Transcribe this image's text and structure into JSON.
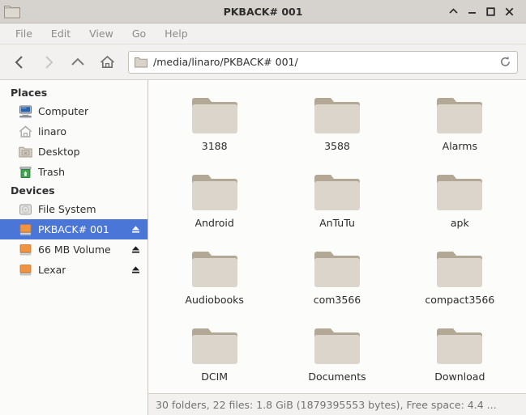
{
  "window": {
    "title": "PKBACK# 001",
    "title_icon": "folder-outline-icon",
    "controls": [
      {
        "name": "shade-button",
        "glyph": "∧"
      },
      {
        "name": "minimize-button",
        "glyph": "–"
      },
      {
        "name": "maximize-button",
        "glyph": "□"
      },
      {
        "name": "close-button",
        "glyph": "✕"
      }
    ]
  },
  "menubar": {
    "items": [
      {
        "label": "File"
      },
      {
        "label": "Edit"
      },
      {
        "label": "View"
      },
      {
        "label": "Go"
      },
      {
        "label": "Help"
      }
    ]
  },
  "toolbar": {
    "back": {
      "name": "back-button",
      "enabled": false
    },
    "forward": {
      "name": "forward-button",
      "enabled": false
    },
    "up": {
      "name": "up-button",
      "enabled": true
    },
    "home": {
      "name": "home-button",
      "enabled": true
    },
    "path": "/media/linaro/PKBACK# 001/",
    "path_icon": "folder-icon",
    "reload_icon": "reload-icon"
  },
  "sidebar": {
    "sections": [
      {
        "header": "Places",
        "items": [
          {
            "label": "Computer",
            "icon": "computer-icon",
            "selected": false,
            "eject": false
          },
          {
            "label": "linaro",
            "icon": "home-icon",
            "selected": false,
            "eject": false
          },
          {
            "label": "Desktop",
            "icon": "desktop-folder-icon",
            "selected": false,
            "eject": false
          },
          {
            "label": "Trash",
            "icon": "trash-icon",
            "selected": false,
            "eject": false
          }
        ]
      },
      {
        "header": "Devices",
        "items": [
          {
            "label": "File System",
            "icon": "harddisk-icon",
            "selected": false,
            "eject": false
          },
          {
            "label": "PKBACK# 001",
            "icon": "removable-drive-icon",
            "selected": true,
            "eject": true
          },
          {
            "label": "66 MB Volume",
            "icon": "removable-drive-icon",
            "selected": false,
            "eject": true
          },
          {
            "label": "Lexar",
            "icon": "removable-drive-icon",
            "selected": false,
            "eject": true
          }
        ]
      }
    ]
  },
  "content": {
    "files": [
      {
        "name": "3188",
        "type": "folder"
      },
      {
        "name": "3588",
        "type": "folder"
      },
      {
        "name": "Alarms",
        "type": "folder"
      },
      {
        "name": "Android",
        "type": "folder"
      },
      {
        "name": "AnTuTu",
        "type": "folder"
      },
      {
        "name": "apk",
        "type": "folder"
      },
      {
        "name": "Audiobooks",
        "type": "folder"
      },
      {
        "name": "com3566",
        "type": "folder"
      },
      {
        "name": "compact3566",
        "type": "folder"
      },
      {
        "name": "DCIM",
        "type": "folder"
      },
      {
        "name": "Documents",
        "type": "folder"
      },
      {
        "name": "Download",
        "type": "folder"
      }
    ]
  },
  "statusbar": {
    "text": "30 folders, 22 files: 1.8 GiB (1879395553 bytes), Free space: 4.4 ..."
  },
  "colors": {
    "selection_blue": "#4a76d8",
    "drive_orange": "#ef9542",
    "folder_body": "#dbd5cb",
    "folder_tab": "#b3a795",
    "titlebar": "#d6d2cd",
    "chrome": "#f2f1f0",
    "trash_green": "#3fa650",
    "computer_blue": "#2a63a8"
  }
}
